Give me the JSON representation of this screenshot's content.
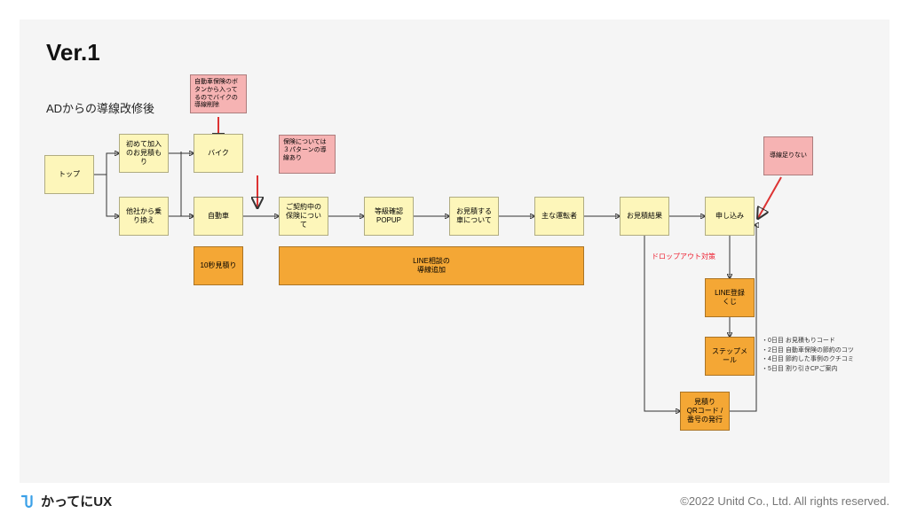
{
  "heading": "Ver.1",
  "subheading": "ADからの導線改修後",
  "nodes": {
    "top": "トップ",
    "first_quote": "初めて加入のお見積もり",
    "switch_other": "他社から乗り換え",
    "bike": "バイク",
    "car": "自動車",
    "ten_sec": "10秒見積り",
    "contract_ins": "ご契約中の保険について",
    "grade_popup": "等級確認POPUP",
    "quote_car": "お見積する車について",
    "main_driver": "主な運転者",
    "quote_result": "お見積結果",
    "apply": "申し込み",
    "line_add": "LINE相談の\n導線追加",
    "line_lottery": "LINE登録\nくじ",
    "step_mail": "ステップメール",
    "qr_issue": "見積り\nQRコード /\n番号の発行"
  },
  "pink_notes": {
    "bike_remove": "自動車保険のボタンから入ってるのでバイクの導線削除",
    "three_pattern": "保険については３パターンの導線あり",
    "not_enough": "導線足りない"
  },
  "dropout_label": "ドロップアウト対策",
  "step_mail_bullets": [
    "・0日目 お見積もりコード",
    "・2日目 自動車保険の節約のコツ",
    "・4日目 節約した事例のクチコミ",
    "・5日目 割り引きCPご案内"
  ],
  "brand": "かってにUX",
  "copyright": "©2022 Unitd Co., Ltd. All rights reserved."
}
